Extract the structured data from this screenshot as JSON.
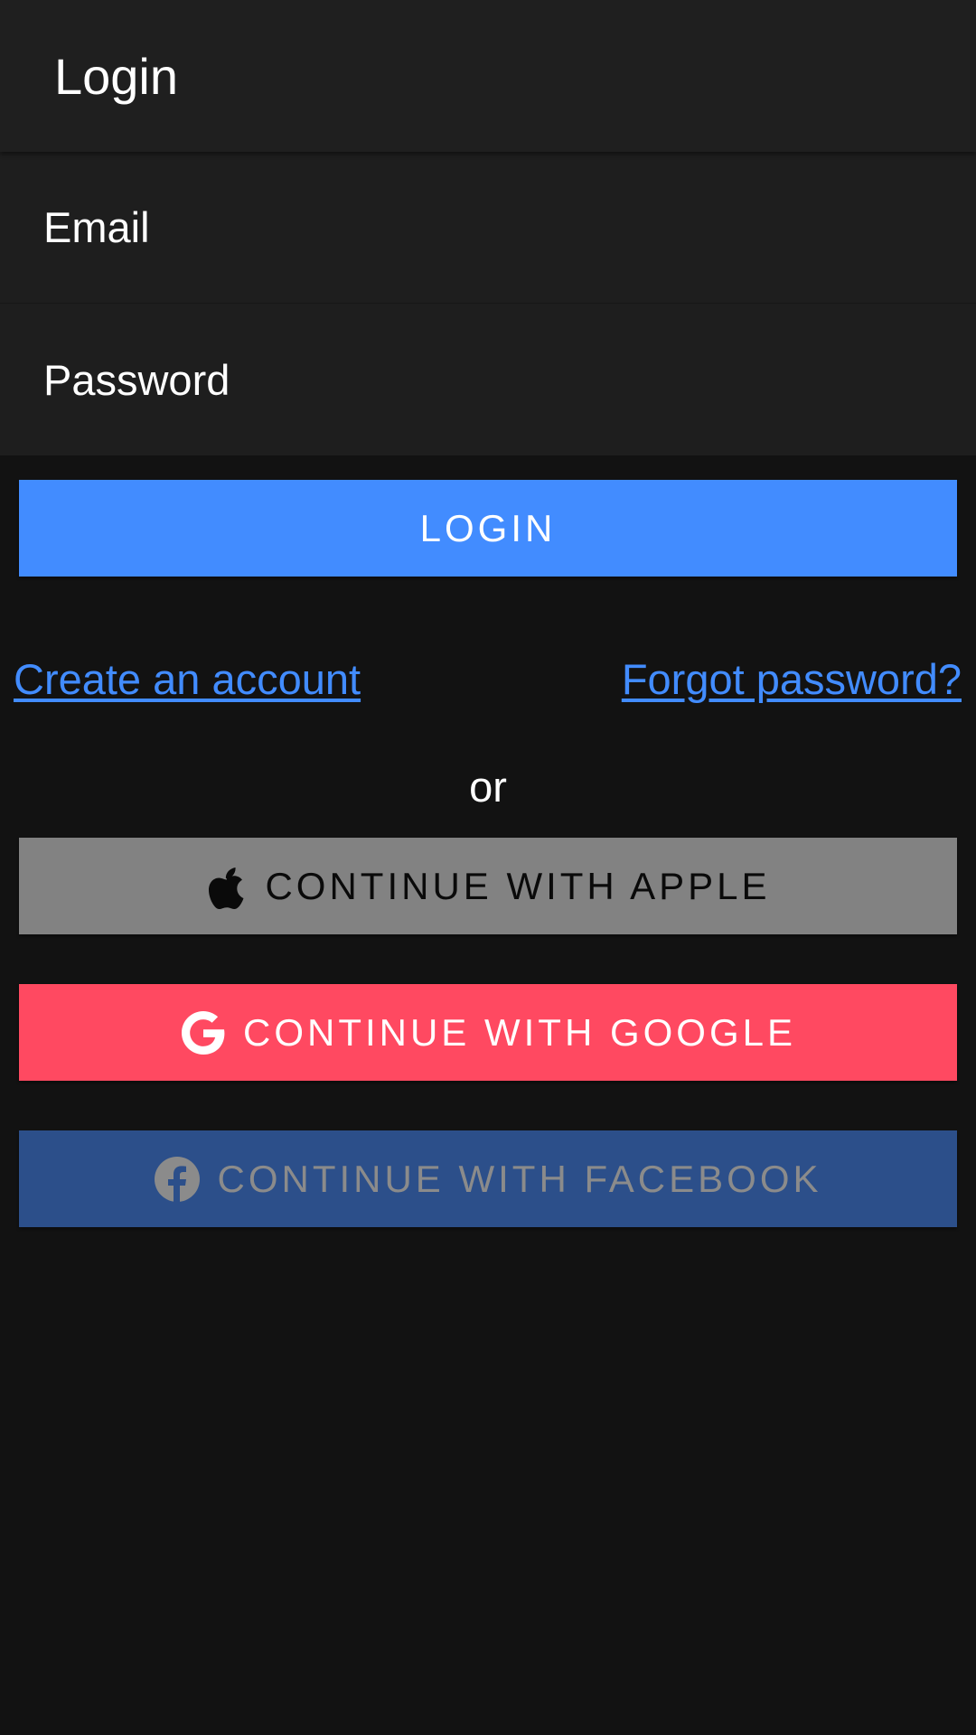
{
  "header": {
    "title": "Login"
  },
  "form": {
    "email_label": "Email",
    "password_label": "Password",
    "login_button": "LOGIN"
  },
  "links": {
    "create_account": "Create an account",
    "forgot_password": "Forgot password?"
  },
  "divider_text": "or",
  "social": {
    "apple": {
      "label": "CONTINUE WITH APPLE",
      "icon": "apple-icon",
      "color": "#828282"
    },
    "google": {
      "label": "CONTINUE WITH GOOGLE",
      "icon": "google-icon",
      "color": "#ff4961"
    },
    "facebook": {
      "label": "CONTINUE WITH FACEBOOK",
      "icon": "facebook-icon",
      "color": "#2c4f8a"
    }
  },
  "colors": {
    "primary": "#428cff",
    "background": "#121212",
    "toolbar": "#1f1f1f"
  }
}
